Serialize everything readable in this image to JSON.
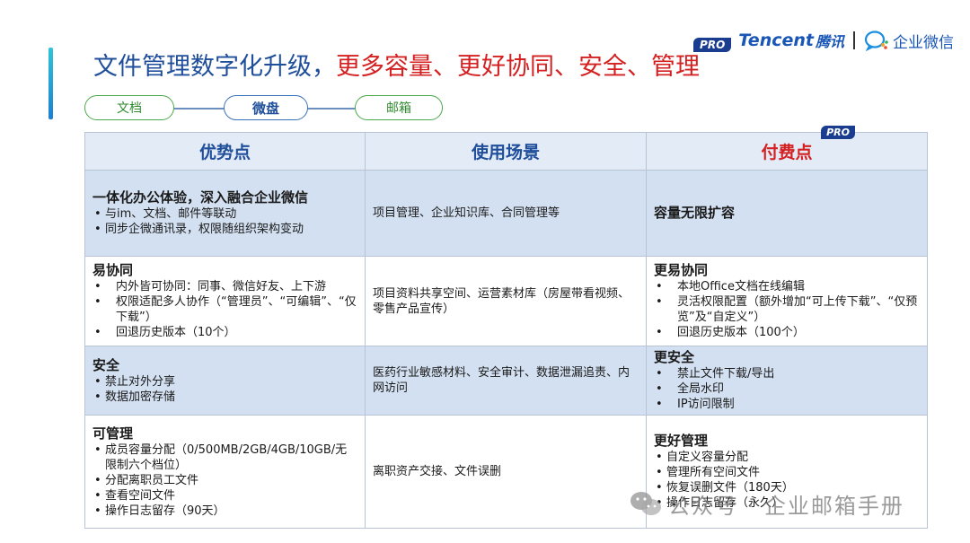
{
  "title": {
    "part1": "文件管理数字化升级，",
    "part2": "更多容量、更好协同、安全、管理"
  },
  "brand": {
    "pro": "PRO",
    "tencent": "Tencent",
    "tencent_cn": "腾讯",
    "wecom": "企业微信"
  },
  "pills": [
    "文档",
    "微盘",
    "邮箱"
  ],
  "table": {
    "headers": [
      "优势点",
      "使用场景",
      "付费点"
    ],
    "header_pro": "PRO",
    "rows": [
      {
        "adv_title": "一体化办公体验，深入融合企业微信",
        "adv_items": [
          "与im、文档、邮件等联动",
          "同步企微通讯录，权限随组织架构变动"
        ],
        "scene": "项目管理、企业知识库、合同管理等",
        "paid_title": "容量无限扩容",
        "paid_items": []
      },
      {
        "adv_title": "易协同",
        "adv_items": [
          "内外皆可协同：同事、微信好友、上下游",
          "权限适配多人协作（“管理员”、“可编辑”、“仅下载”）",
          "回退历史版本（10个）"
        ],
        "scene": "项目资料共享空间、运营素材库（房屋带看视频、零售产品宣传）",
        "paid_title": "更易协同",
        "paid_items": [
          "本地Office文档在线编辑",
          "灵活权限配置（额外增加“可上传下载”、“仅预览”及“自定义”）",
          "回退历史版本（100个）"
        ]
      },
      {
        "adv_title": "安全",
        "adv_items": [
          "禁止对外分享",
          "数据加密存储"
        ],
        "scene": "医药行业敏感材料、安全审计、数据泄漏追责、内网访问",
        "paid_title": "更安全",
        "paid_items": [
          "禁止文件下载/导出",
          "全局水印",
          "IP访问限制"
        ]
      },
      {
        "adv_title": "可管理",
        "adv_items": [
          "成员容量分配（0/500MB/2GB/4GB/10GB/无限制六个档位）",
          "分配离职员工文件",
          "查看空间文件",
          "操作日志留存（90天）"
        ],
        "scene": "离职资产交接、文件误删",
        "paid_title": "更好管理",
        "paid_items": [
          "自定义容量分配",
          "管理所有空间文件",
          "恢复误删文件（180天）",
          "操作日志留存（永久）"
        ]
      }
    ]
  },
  "watermark": "公众号 · 企业邮箱手册"
}
